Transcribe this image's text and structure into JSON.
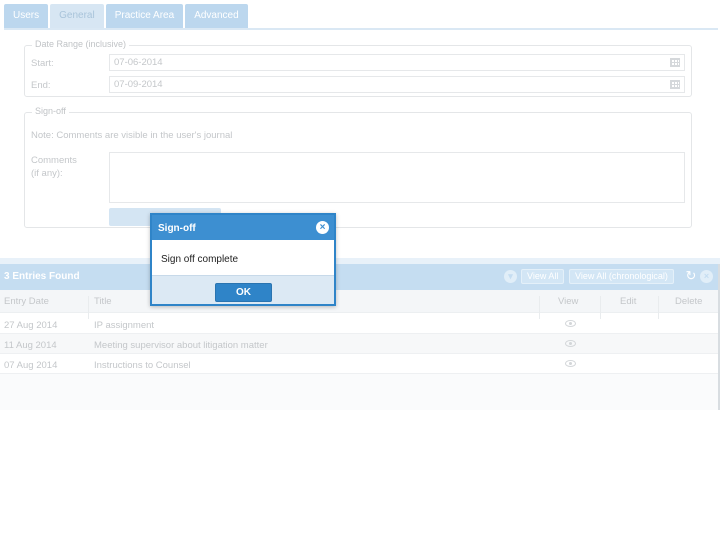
{
  "tabs": [
    {
      "label": "Users"
    },
    {
      "label": "General"
    },
    {
      "label": "Practice Area"
    },
    {
      "label": "Advanced"
    }
  ],
  "date_range": {
    "legend": "Date Range (inclusive)",
    "start_label": "Start:",
    "start_value": "07-06-2014",
    "end_label": "End:",
    "end_value": "07-09-2014"
  },
  "signoff": {
    "legend": "Sign-off",
    "note": "Note: Comments are visible in the user's journal",
    "comments_label_1": "Comments",
    "comments_label_2": "(if any):",
    "comments_value": ""
  },
  "results": {
    "title": "3 Entries Found",
    "view_all": "View All",
    "view_all_chrono": "View All (chronological)",
    "columns": {
      "entry_date": "Entry Date",
      "title": "Title",
      "view": "View",
      "edit": "Edit",
      "delete": "Delete"
    },
    "rows": [
      {
        "date": "27 Aug 2014",
        "title": "IP assignment"
      },
      {
        "date": "11 Aug 2014",
        "title": "Meeting supervisor about litigation matter"
      },
      {
        "date": "07 Aug 2014",
        "title": "Instructions to Counsel"
      }
    ]
  },
  "icons": {
    "calendar": "calendar-icon",
    "close": "close-icon",
    "collapse": "chevron-down-icon",
    "refresh": "refresh-icon",
    "eye": "eye-icon"
  },
  "colors": {
    "accent": "#3d8fd1",
    "modal_footer": "#dce9f4"
  },
  "modal": {
    "title": "Sign-off",
    "message": "Sign off complete",
    "ok_label": "OK"
  }
}
